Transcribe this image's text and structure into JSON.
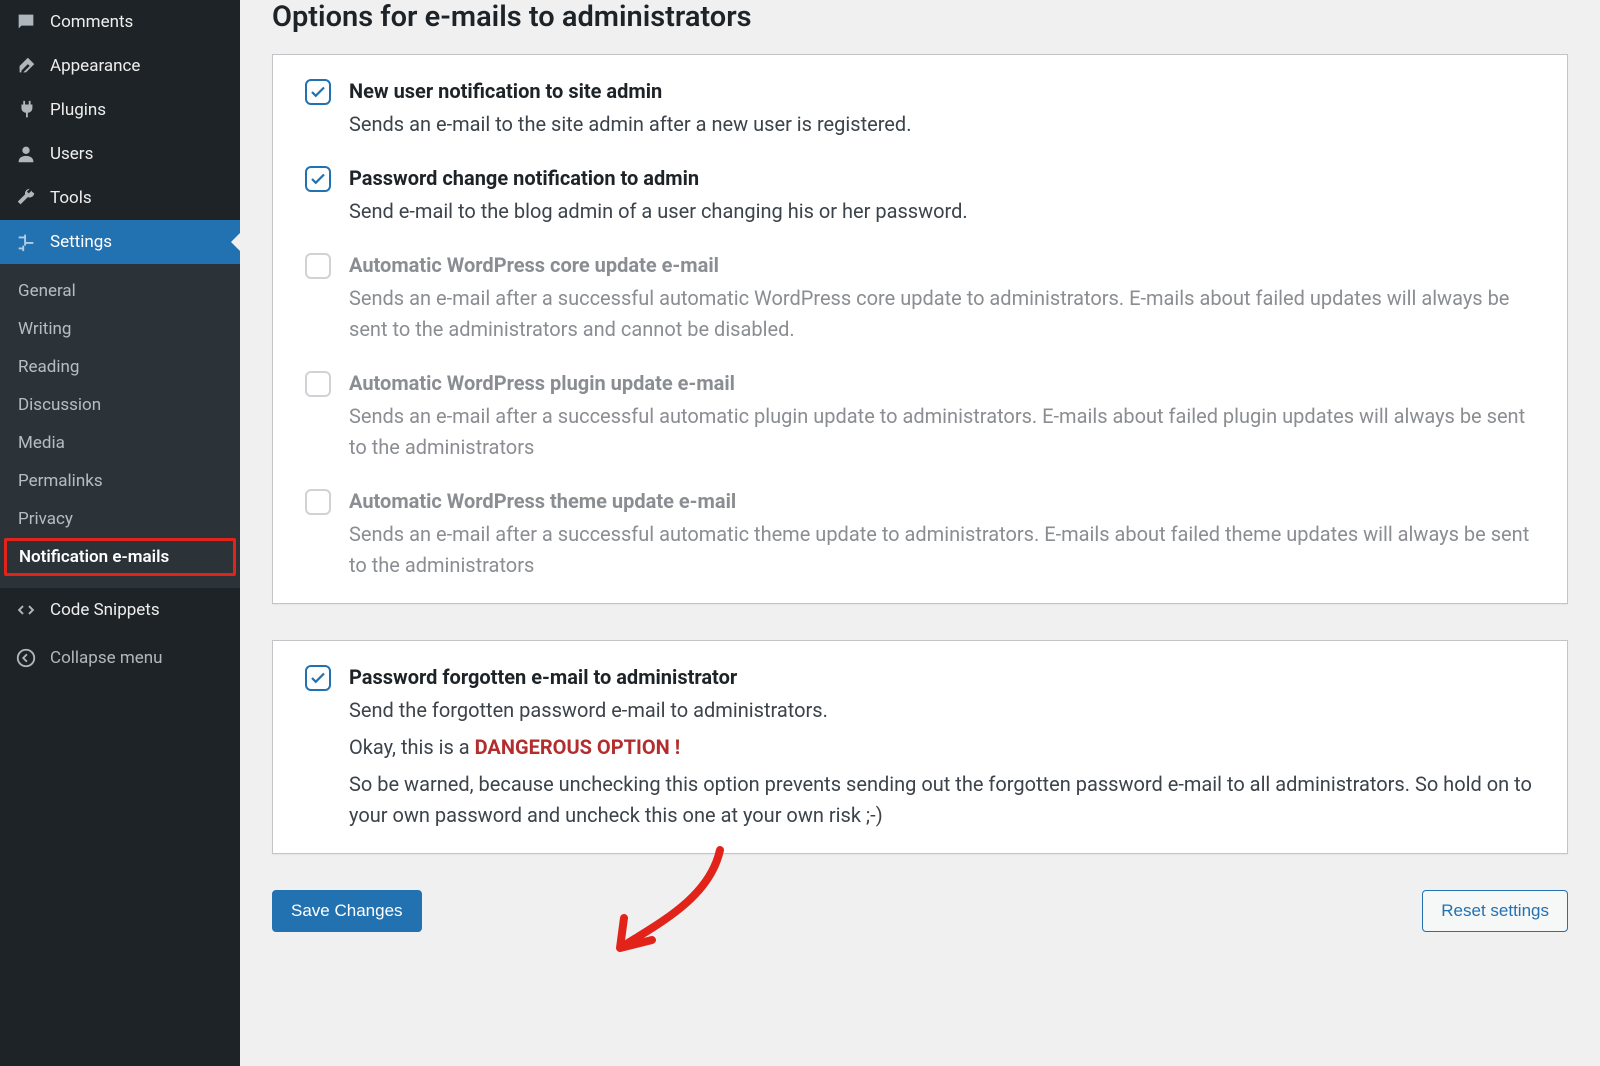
{
  "sidebar": {
    "items": [
      {
        "label": "Comments",
        "icon": "comment-icon"
      },
      {
        "label": "Appearance",
        "icon": "brush-icon"
      },
      {
        "label": "Plugins",
        "icon": "plug-icon"
      },
      {
        "label": "Users",
        "icon": "user-icon"
      },
      {
        "label": "Tools",
        "icon": "wrench-icon"
      },
      {
        "label": "Settings",
        "icon": "sliders-icon",
        "current": true
      }
    ],
    "submenu": [
      {
        "label": "General"
      },
      {
        "label": "Writing"
      },
      {
        "label": "Reading"
      },
      {
        "label": "Discussion"
      },
      {
        "label": "Media"
      },
      {
        "label": "Permalinks"
      },
      {
        "label": "Privacy"
      },
      {
        "label": "Notification e-mails",
        "highlighted": true
      }
    ],
    "after_items": [
      {
        "label": "Code Snippets",
        "icon": "code-icon"
      }
    ],
    "collapse_label": "Collapse menu"
  },
  "page": {
    "title": "Options for e-mails to administrators"
  },
  "panel1": {
    "options": [
      {
        "checked": true,
        "disabled": false,
        "title": "New user notification to site admin",
        "desc": "Sends an e-mail to the site admin after a new user is registered."
      },
      {
        "checked": true,
        "disabled": false,
        "title": "Password change notification to admin",
        "desc": "Send e-mail to the blog admin of a user changing his or her password."
      },
      {
        "checked": false,
        "disabled": true,
        "title": "Automatic WordPress core update e-mail",
        "desc": "Sends an e-mail after a successful automatic WordPress core update to administrators. E-mails about failed updates will always be sent to the administrators and cannot be disabled."
      },
      {
        "checked": false,
        "disabled": true,
        "title": "Automatic WordPress plugin update e-mail",
        "desc": "Sends an e-mail after a successful automatic plugin update to administrators. E-mails about failed plugin updates will always be sent to the administrators"
      },
      {
        "checked": false,
        "disabled": true,
        "title": "Automatic WordPress theme update e-mail",
        "desc": "Sends an e-mail after a successful automatic theme update to administrators. E-mails about failed theme updates will always be sent to the administrators"
      }
    ]
  },
  "panel2": {
    "option": {
      "checked": true,
      "title": "Password forgotten e-mail to administrator",
      "desc": "Send the forgotten password e-mail to administrators.",
      "warn_prefix": "Okay, this is a ",
      "warn_strong": "DANGEROUS OPTION !",
      "warn_body": "So be warned, because unchecking this option prevents sending out the forgotten password e-mail to all administrators. So hold on to your own password and uncheck this one at your own risk ;-)"
    }
  },
  "buttons": {
    "save": "Save Changes",
    "reset": "Reset settings"
  }
}
